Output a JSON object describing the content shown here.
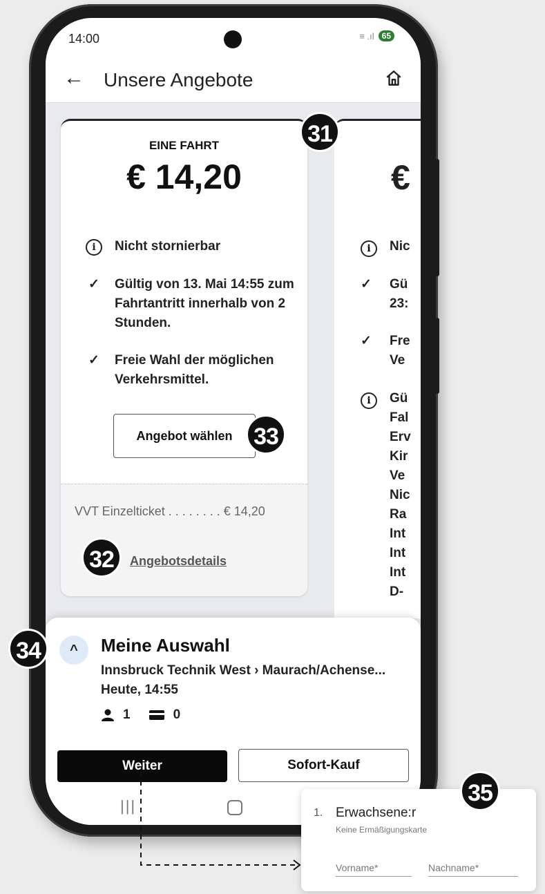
{
  "status": {
    "time": "14:00",
    "battery": "65",
    "signal": "≡ .ıl"
  },
  "appbar": {
    "back_icon": "arrow-left-icon",
    "title": "Unsere Angebote",
    "home_icon": "home-icon"
  },
  "offer": {
    "kicker": "EINE FAHRT",
    "price": "€ 14,20",
    "features": [
      {
        "icon": "info-icon",
        "text": "Nicht stornierbar"
      },
      {
        "icon": "check-icon",
        "text": "Gültig von 13. Mai 14:55 zum Fahrtantritt innerhalb von 2 Stunden."
      },
      {
        "icon": "check-icon",
        "text": "Freie Wahl der möglichen Verkehrsmittel."
      }
    ],
    "choose_label": "Angebot wählen",
    "ticket_line": "VVT Einzelticket . . . . . . . . € 14,20",
    "details_link": "Angebotsdetails"
  },
  "offer2": {
    "kicker_fragment": "-",
    "price_fragment": "€",
    "lines": [
      "Nic",
      "Gü",
      "23:",
      "Fre",
      "Ve",
      "Gü",
      "Fal",
      "Erv",
      "Kir",
      "Ve",
      "Nic",
      "Ra",
      "Int",
      "Int",
      "Int",
      "D-"
    ]
  },
  "selection": {
    "expand_icon": "chevron-up-icon",
    "title": "Meine Auswahl",
    "route": "Innsbruck Technik West › Maurach/Achense...",
    "date": "Heute, 14:55",
    "persons": "1",
    "cards": "0",
    "next_label": "Weiter",
    "buy_label": "Sofort-Kauf"
  },
  "navbar": {
    "recents": "|||",
    "home": "home-nav"
  },
  "badges": {
    "b31": "31",
    "b32": "32",
    "b33": "33",
    "b34": "34",
    "b35": "35"
  },
  "popup": {
    "number": "1.",
    "title": "Erwachsene:r",
    "subtitle": "Keine Ermäßigungskarte",
    "firstname_placeholder": "Vorname*",
    "lastname_placeholder": "Nachname*"
  }
}
